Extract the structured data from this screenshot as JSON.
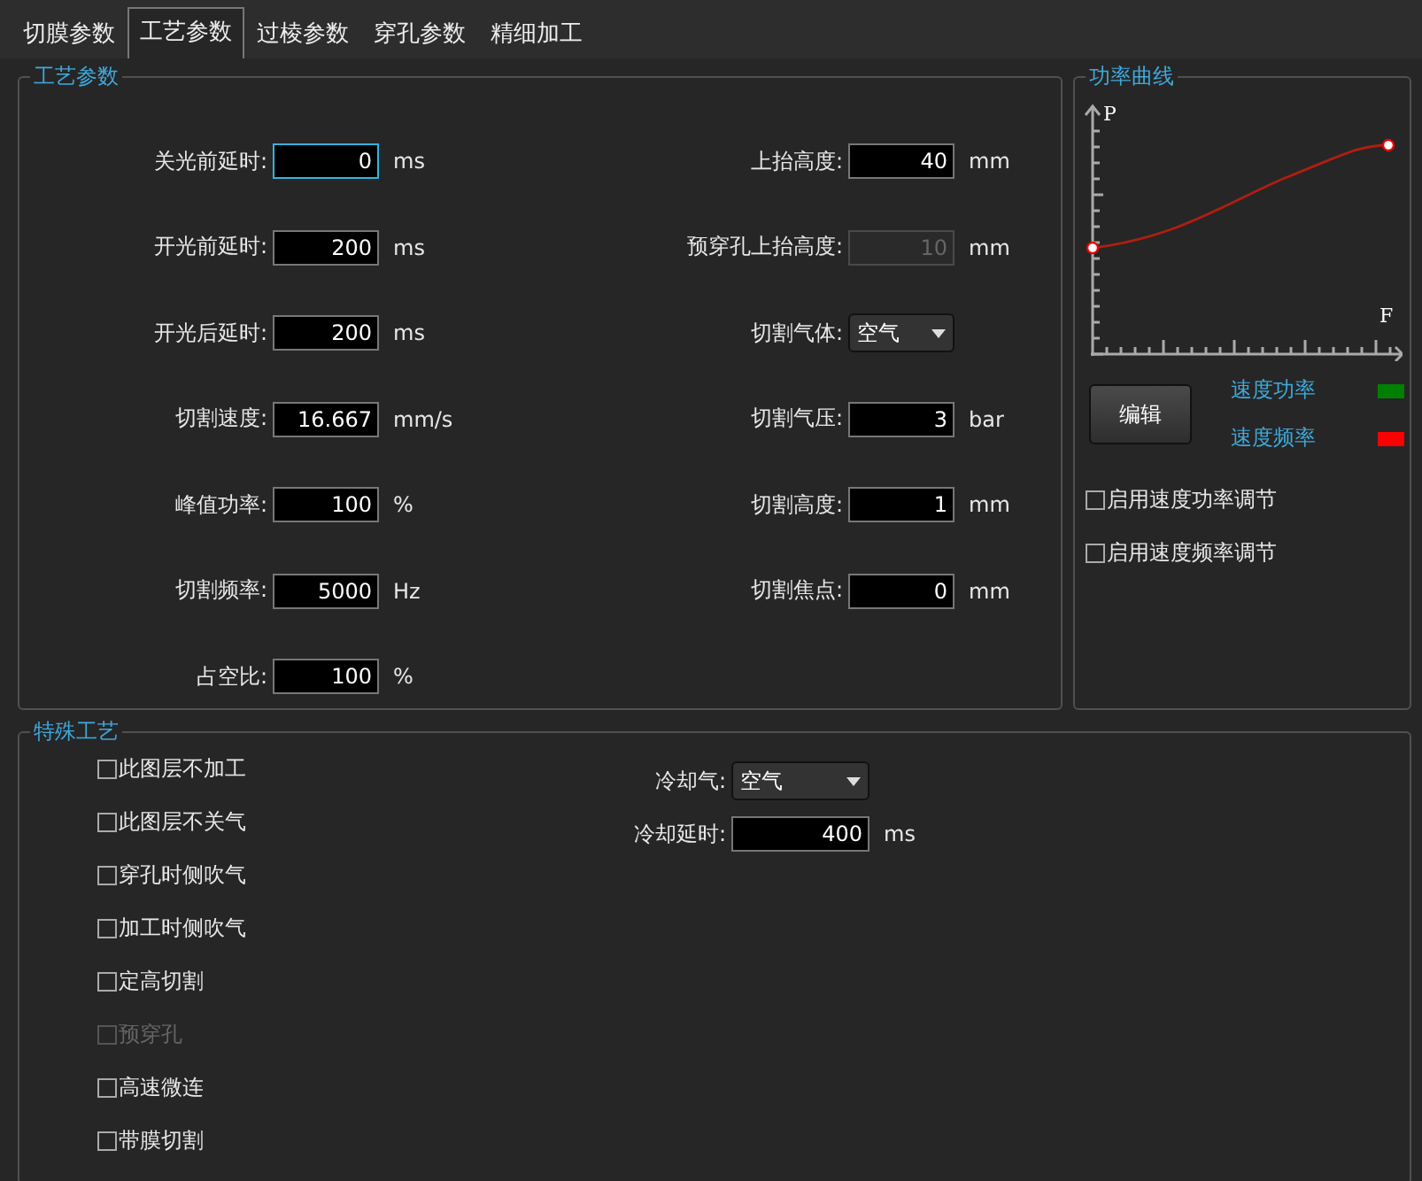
{
  "tabs": [
    {
      "label": "切膜参数",
      "selected": false
    },
    {
      "label": "工艺参数",
      "selected": true
    },
    {
      "label": "过棱参数",
      "selected": false
    },
    {
      "label": "穿孔参数",
      "selected": false
    },
    {
      "label": "精细加工",
      "selected": false
    }
  ],
  "process_group": {
    "title": "工艺参数",
    "left_fields": [
      {
        "kind": "input",
        "label": "关光前延时:",
        "value": "0",
        "unit": "ms",
        "focused": true,
        "disabled": false
      },
      {
        "kind": "input",
        "label": "开光前延时:",
        "value": "200",
        "unit": "ms",
        "focused": false,
        "disabled": false
      },
      {
        "kind": "input",
        "label": "开光后延时:",
        "value": "200",
        "unit": "ms",
        "focused": false,
        "disabled": false
      },
      {
        "kind": "input",
        "label": "切割速度:",
        "value": "16.667",
        "unit": "mm/s",
        "focused": false,
        "disabled": false
      },
      {
        "kind": "input",
        "label": "峰值功率:",
        "value": "100",
        "unit": "%",
        "focused": false,
        "disabled": false
      },
      {
        "kind": "input",
        "label": "切割频率:",
        "value": "5000",
        "unit": "Hz",
        "focused": false,
        "disabled": false
      },
      {
        "kind": "input",
        "label": "占空比:",
        "value": "100",
        "unit": "%",
        "focused": false,
        "disabled": false
      }
    ],
    "right_fields": [
      {
        "kind": "input",
        "label": "上抬高度:",
        "value": "40",
        "unit": "mm",
        "focused": false,
        "disabled": false
      },
      {
        "kind": "input",
        "label": "预穿孔上抬高度:",
        "value": "10",
        "unit": "mm",
        "focused": false,
        "disabled": true
      },
      {
        "kind": "select",
        "label": "切割气体:",
        "value": "空气"
      },
      {
        "kind": "input",
        "label": "切割气压:",
        "value": "3",
        "unit": "bar",
        "focused": false,
        "disabled": false
      },
      {
        "kind": "input",
        "label": "切割高度:",
        "value": "1",
        "unit": "mm",
        "focused": false,
        "disabled": false
      },
      {
        "kind": "input",
        "label": "切割焦点:",
        "value": "0",
        "unit": "mm",
        "focused": false,
        "disabled": false
      }
    ]
  },
  "power_curve_group": {
    "title": "功率曲线",
    "y_axis_label": "P",
    "x_axis_label": "F",
    "edit_button": "编辑",
    "legend": [
      {
        "label": "速度功率",
        "color": "#008000"
      },
      {
        "label": "速度频率",
        "color": "#ff0000"
      }
    ],
    "checkboxes": [
      {
        "label": "启用速度功率调节",
        "checked": false,
        "disabled": false
      },
      {
        "label": "启用速度频率调节",
        "checked": false,
        "disabled": false
      }
    ]
  },
  "special_group": {
    "title": "特殊工艺",
    "checkboxes": [
      {
        "label": "此图层不加工",
        "checked": false,
        "disabled": false
      },
      {
        "label": "此图层不关气",
        "checked": false,
        "disabled": false
      },
      {
        "label": "穿孔时侧吹气",
        "checked": false,
        "disabled": false
      },
      {
        "label": "加工时侧吹气",
        "checked": false,
        "disabled": false
      },
      {
        "label": "定高切割",
        "checked": false,
        "disabled": false
      },
      {
        "label": "预穿孔",
        "checked": false,
        "disabled": true
      },
      {
        "label": "高速微连",
        "checked": false,
        "disabled": false
      },
      {
        "label": "带膜切割",
        "checked": false,
        "disabled": false
      }
    ],
    "fields": [
      {
        "kind": "select",
        "label": "冷却气:",
        "value": "空气"
      },
      {
        "kind": "input",
        "label": "冷却延时:",
        "value": "400",
        "unit": "ms",
        "focused": false,
        "disabled": false
      }
    ]
  }
}
